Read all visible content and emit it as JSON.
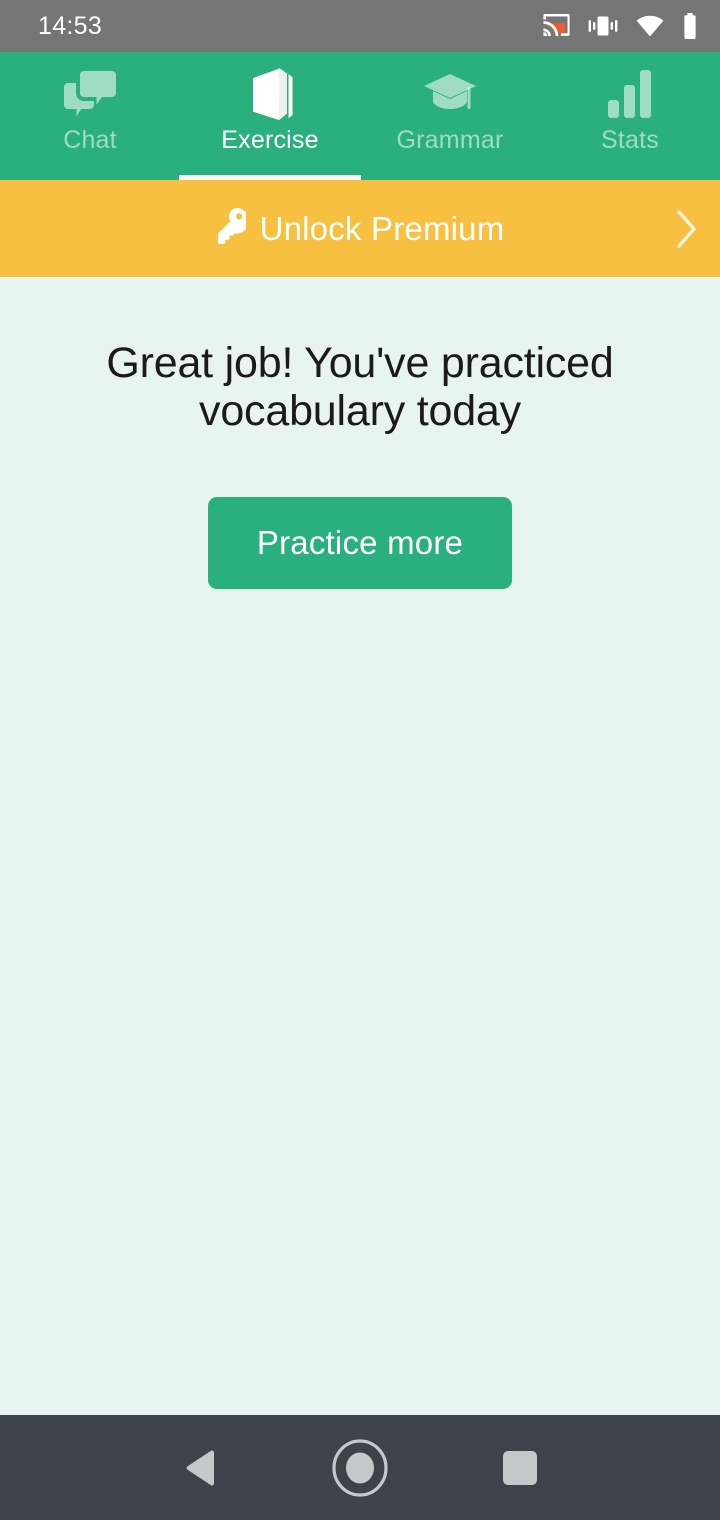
{
  "status_bar": {
    "time": "14:53",
    "icons": [
      {
        "name": "cast-icon",
        "label": "Cast"
      },
      {
        "name": "vibrate-icon",
        "label": "Vibrate"
      },
      {
        "name": "wifi-icon",
        "label": "Wi-Fi"
      },
      {
        "name": "battery-icon",
        "label": "Battery"
      }
    ],
    "background_color": "#757575",
    "text_color": "#ffffff",
    "cast_accent_color": "#ef5a30"
  },
  "tabs": {
    "active_index": 1,
    "background_color": "#2aaf7f",
    "active_color": "#ffffff",
    "inactive_color": "rgba(255,255,255,0.55)",
    "items": [
      {
        "label": "Chat",
        "icon": "chat-bubbles-icon",
        "active": false
      },
      {
        "label": "Exercise",
        "icon": "book-icon",
        "active": true
      },
      {
        "label": "Grammar",
        "icon": "graduation-cap-icon",
        "active": false
      },
      {
        "label": "Stats",
        "icon": "bar-chart-icon",
        "active": false
      }
    ]
  },
  "banner": {
    "label": "Unlock Premium",
    "icon": "key-icon",
    "chevron": "chevron-right-icon",
    "background_color": "#f8c040",
    "text_color": "#ffffff"
  },
  "main": {
    "headline": "Great job! You've practiced vocabulary today",
    "cta_label": "Practice more",
    "background_color": "#e8f4ef",
    "headline_color": "#1b1b1b",
    "cta_background_color": "#2aaf7f",
    "cta_text_color": "#ffffff"
  },
  "nav_bar": {
    "background_color": "#3c434a",
    "icon_color": "#c3c8cb",
    "buttons": [
      {
        "name": "back-button",
        "icon": "triangle-left-icon"
      },
      {
        "name": "home-button",
        "icon": "circle-icon"
      },
      {
        "name": "recents-button",
        "icon": "square-icon"
      }
    ]
  }
}
